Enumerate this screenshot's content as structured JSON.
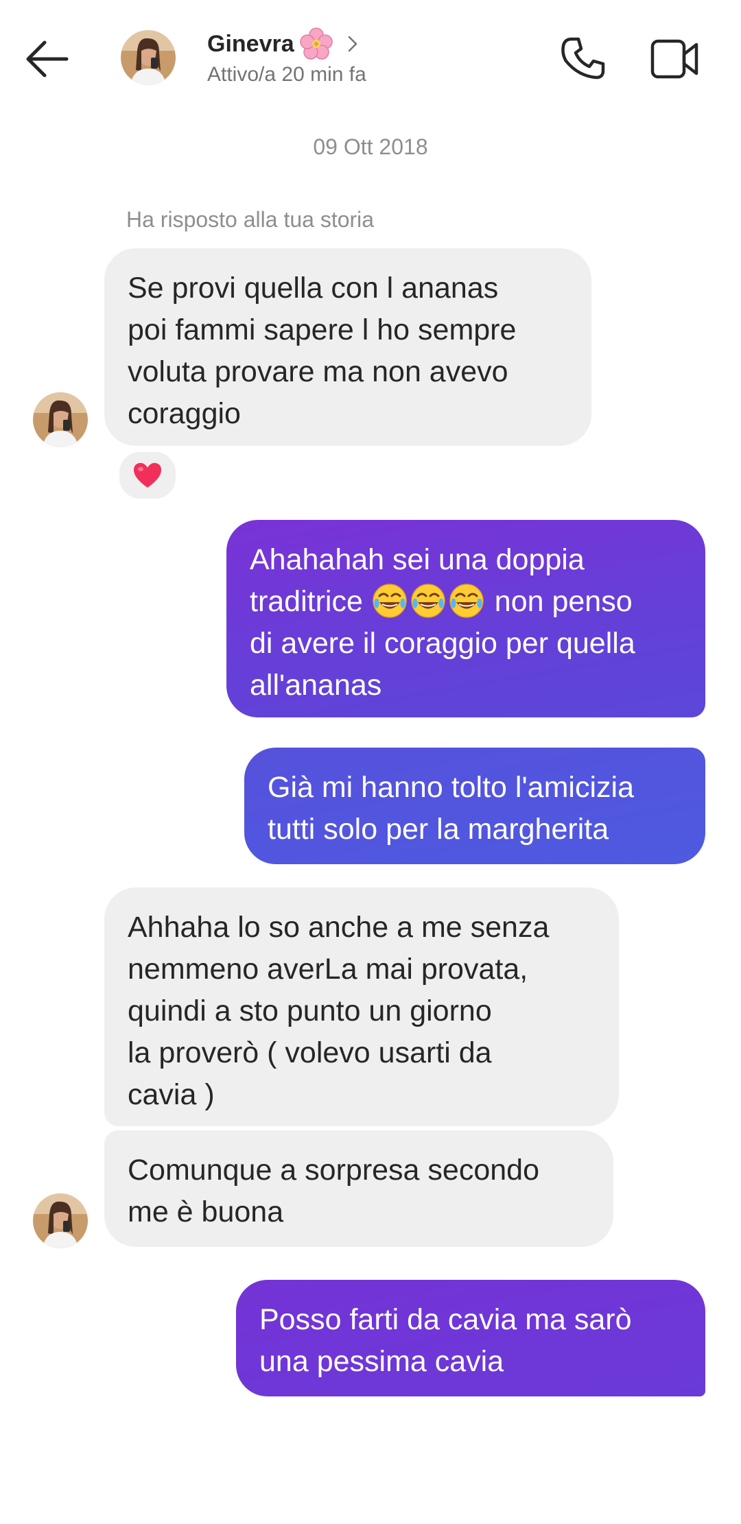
{
  "header": {
    "contact_name": "Ginevra",
    "status": "Attivo/a 20 min fa"
  },
  "thread": {
    "date": "09 Ott 2018",
    "reply_note": "Ha risposto alla tua storia"
  },
  "messages": [
    {
      "direction": "incoming",
      "text": "Se provi quella con l ananas\npoi fammi sapere l ho sempre\nvoluta provare ma non avevo\ncoraggio",
      "reaction": "heart"
    },
    {
      "direction": "outgoing",
      "text_before": "Ahahahah sei una doppia\ntraditrice ",
      "emoji": [
        "tears-of-joy",
        "tears-of-joy",
        "tears-of-joy"
      ],
      "text_after": " non penso\ndi avere il coraggio per quella\nall'ananas"
    },
    {
      "direction": "outgoing",
      "text": "Già mi hanno tolto l'amicizia\ntutti solo per la margherita"
    },
    {
      "direction": "incoming",
      "text": "Ahhaha lo so anche a me senza\nnemmeno averLa mai provata,\nquindi a sto punto un giorno\nla proverò ( volevo usarti da\ncavia )"
    },
    {
      "direction": "incoming",
      "text": "Comunque a sorpresa secondo\nme è buona"
    },
    {
      "direction": "outgoing",
      "text": "Posso farti da cavia ma sarò\nuna pessima cavia"
    }
  ],
  "colors": {
    "incoming_bubble": "#efefef",
    "outgoing_top": "#7a32d6",
    "outgoing_bottom": "#4f5ae0",
    "icon": "#262626",
    "secondary_text": "#8e8e8e"
  },
  "icons": {
    "back": "arrow-left-icon",
    "call": "phone-icon",
    "video": "video-camera-icon",
    "flower": "cherry-blossom-icon",
    "chevron": "chevron-right-icon",
    "reaction": "heart-icon",
    "emoji": "tears-of-joy-icon"
  }
}
